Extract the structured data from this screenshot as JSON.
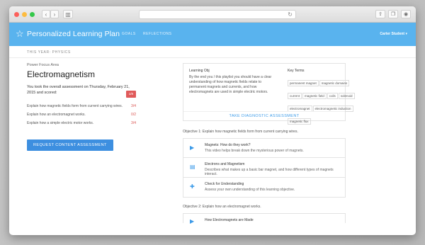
{
  "app": {
    "title": "Personalized Learning Plan",
    "nav": [
      "GOALS",
      "REFLECTIONS"
    ],
    "user": "Carter Student ▾",
    "subtitle": "THIS YEAR: PHYSICS"
  },
  "left": {
    "pfa_label": "Power Focus Area",
    "subject": "Electromagnetism",
    "took_text": "You took the overall assessment on Thursday, February 21, 2015 and scored:",
    "took_score": "1/8",
    "objectives": [
      {
        "text": "Explain how magnetic fields form from current carrying wires.",
        "score": "3/4"
      },
      {
        "text": "Explain how an electromagnet works.",
        "score": "0/2"
      },
      {
        "text": "Explain how a simple electric motor works.",
        "score": "3/4"
      }
    ],
    "request_button": "REQUEST CONTENT ASSESSMENT"
  },
  "summary": {
    "learning_obj_title": "Learning Obj",
    "learning_obj_text": "By the end you / this playlist you should have a clear understanding of how magnetic fields relate to permanent magnets and currents, and how electromagnets are used in simple electric motors.",
    "key_terms_title": "Key Terms",
    "terms": [
      "permanent magnet",
      "magnetic domains",
      "current",
      "magnetic field",
      "coils",
      "solenoid",
      "electromagnet",
      "electromagnetic induction",
      "magnetic flux"
    ],
    "diagnostic_link": "TAKE DIAGNOSTIC ASSESSMENT"
  },
  "objective1": {
    "heading": "Objective 1: Explain how magnetic fields form from current carrying wires.",
    "lessons": [
      {
        "title": "Magnets: How do they work?",
        "desc": "This video helps break down the mysterious power of magnets.",
        "icon": "video-icon"
      },
      {
        "title": "Electrons and Magnetism",
        "desc": "Describes what makes up a basic bar magnet, and how different types of magnets interact.",
        "icon": "document-icon"
      },
      {
        "title": "Check for Understanding",
        "desc": "Assess your own understanding of this learning objective.",
        "icon": "quiz-icon"
      }
    ]
  },
  "objective2": {
    "heading": "Objective 2: Explain how an electromagnet works.",
    "lessons": [
      {
        "title": "How Electromagnets are Made",
        "icon": "video-icon"
      }
    ]
  },
  "colors": {
    "accent": "#59b3ee",
    "button": "#3d8fe0",
    "alert": "#e05a5a"
  }
}
